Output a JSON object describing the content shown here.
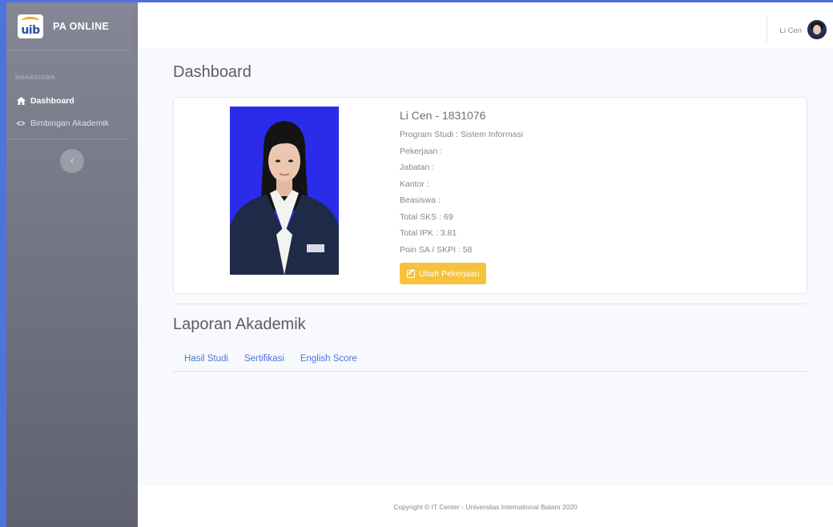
{
  "app": {
    "brand_logo_text": "uib",
    "brand_name": "PA ONLINE"
  },
  "sidebar": {
    "heading": "MAHASISWA",
    "items": [
      {
        "label": "Dashboard",
        "icon": "home-icon",
        "active": true
      },
      {
        "label": "Bimbingan Akademik",
        "icon": "eye-icon",
        "active": false
      }
    ],
    "toggle_icon": "chevron-left-icon"
  },
  "topbar": {
    "user_name": "Li Cen",
    "avatar": "user-avatar"
  },
  "main": {
    "page_title": "Dashboard",
    "profile": {
      "name_line": "Li Cen - 1831076",
      "program_studi": "Program Studi : Sistem Informasi",
      "pekerjaan": "Pekerjaan :",
      "jabatan": "Jabatan :",
      "kantor": "Kantor :",
      "beasiswa": "Beasiswa :",
      "total_sks": "Total SKS : 69",
      "total_ipk": "Total IPK : 3.81",
      "poin": "Poin SA / SKPI : 58",
      "edit_button": "Ubah Pekerjaan"
    },
    "section_title": "Laporan Akademik",
    "tabs": [
      "Hasil Studi",
      "Sertifikasi",
      "English Score"
    ]
  },
  "footer": {
    "copyright": "Copyright © IT Center - Universitas International Batam 2020"
  },
  "colors": {
    "primary": "#4e73df",
    "sidebar_gradient_top": "#858796",
    "warning": "#f6c23e",
    "photo_background": "#2b2ce9"
  }
}
